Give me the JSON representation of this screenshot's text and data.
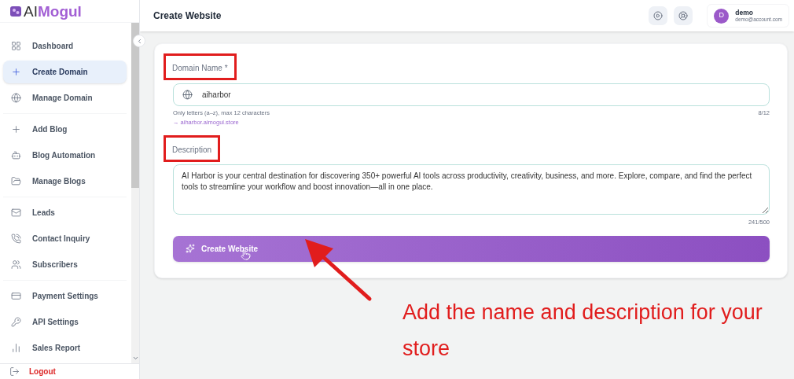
{
  "brand": {
    "prefix": "AI",
    "name": "Mogul"
  },
  "sidebar": {
    "groups": [
      {
        "items": [
          {
            "label": "Dashboard",
            "selected": false
          },
          {
            "label": "Create Domain",
            "selected": true
          },
          {
            "label": "Manage Domain",
            "selected": false
          }
        ]
      },
      {
        "items": [
          {
            "label": "Add Blog",
            "selected": false
          },
          {
            "label": "Blog Automation",
            "selected": false
          },
          {
            "label": "Manage Blogs",
            "selected": false
          }
        ]
      },
      {
        "items": [
          {
            "label": "Leads",
            "selected": false
          },
          {
            "label": "Contact Inquiry",
            "selected": false
          },
          {
            "label": "Subscribers",
            "selected": false
          }
        ]
      },
      {
        "items": [
          {
            "label": "Payment Settings",
            "selected": false
          },
          {
            "label": "API Settings",
            "selected": false
          },
          {
            "label": "Sales Report",
            "selected": false
          }
        ]
      }
    ],
    "logout": "Logout"
  },
  "header": {
    "title": "Create Website",
    "user": {
      "initial": "D",
      "name": "demo",
      "email": "demo@account.com"
    }
  },
  "form": {
    "domain": {
      "label": "Domain Name *",
      "highlighted": true,
      "value": "aiharbor",
      "hint": "Only letters (a–z), max 12 characters",
      "preview": "→ aiharbor.aimogul.store",
      "count": "8/12"
    },
    "description": {
      "label": "Description",
      "highlighted": true,
      "value": "AI Harbor is your central destination for discovering 350+ powerful AI tools across productivity, creativity, business, and more. Explore, compare, and find the perfect tools to streamline your workflow and boost innovation—all in one place.",
      "count": "241/500"
    },
    "submit": "Create Website"
  },
  "annotation": {
    "text": "Add the name and description for your store"
  }
}
